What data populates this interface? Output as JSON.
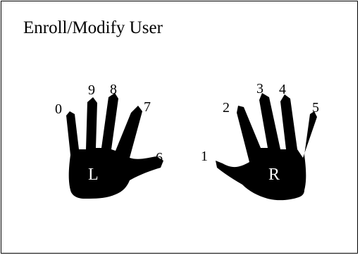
{
  "window": {
    "title": "Enroll/Modify User"
  },
  "colors": {
    "hand_fill": "#000000",
    "background": "#ffffff",
    "hand_letter": "#ffffff"
  },
  "hands": {
    "left": {
      "letter": "L",
      "icon": "left-hand-icon",
      "fingers": [
        "0",
        "9",
        "8",
        "7",
        "6"
      ]
    },
    "right": {
      "letter": "R",
      "icon": "right-hand-icon",
      "fingers": [
        "1",
        "2",
        "3",
        "4",
        "5"
      ]
    }
  }
}
